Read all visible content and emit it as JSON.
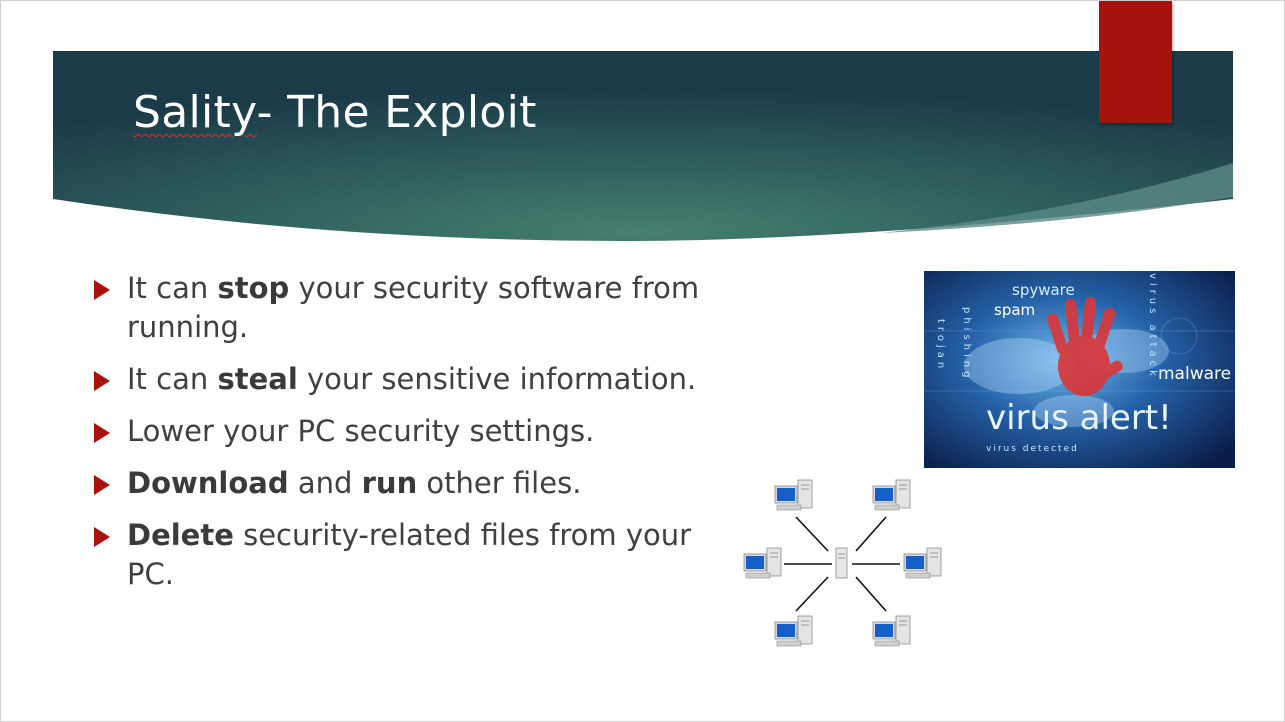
{
  "slide": {
    "title_underlined": "Sality",
    "title_rest": "- The Exploit",
    "bullets": [
      {
        "parts": [
          {
            "t": "It can ",
            "b": false
          },
          {
            "t": "stop",
            "b": true
          },
          {
            "t": " your security software from running.",
            "b": false
          }
        ]
      },
      {
        "parts": [
          {
            "t": "It can ",
            "b": false
          },
          {
            "t": "steal",
            "b": true
          },
          {
            "t": " your sensitive information.",
            "b": false
          }
        ]
      },
      {
        "parts": [
          {
            "t": "Lower your PC security settings.",
            "b": false
          }
        ]
      },
      {
        "parts": [
          {
            "t": "Download",
            "b": true
          },
          {
            "t": " and ",
            "b": false
          },
          {
            "t": "run",
            "b": true
          },
          {
            "t": " other files.",
            "b": false
          }
        ]
      },
      {
        "parts": [
          {
            "t": "Delete",
            "b": true
          },
          {
            "t": " security-related files from your PC.",
            "b": false
          }
        ]
      }
    ],
    "image": {
      "words": {
        "spyware": "spyware",
        "spam": "spam",
        "malware": "malware",
        "headline": "virus alert!",
        "caption": "virus detected",
        "vertical1": "trojan",
        "vertical2": "phishing",
        "vertical3": "virus attack"
      }
    },
    "colors": {
      "banner_dark": "#1b3b48",
      "banner_light": "#3f7a6c",
      "accent_red": "#a8120c",
      "body_text": "#404040"
    }
  }
}
